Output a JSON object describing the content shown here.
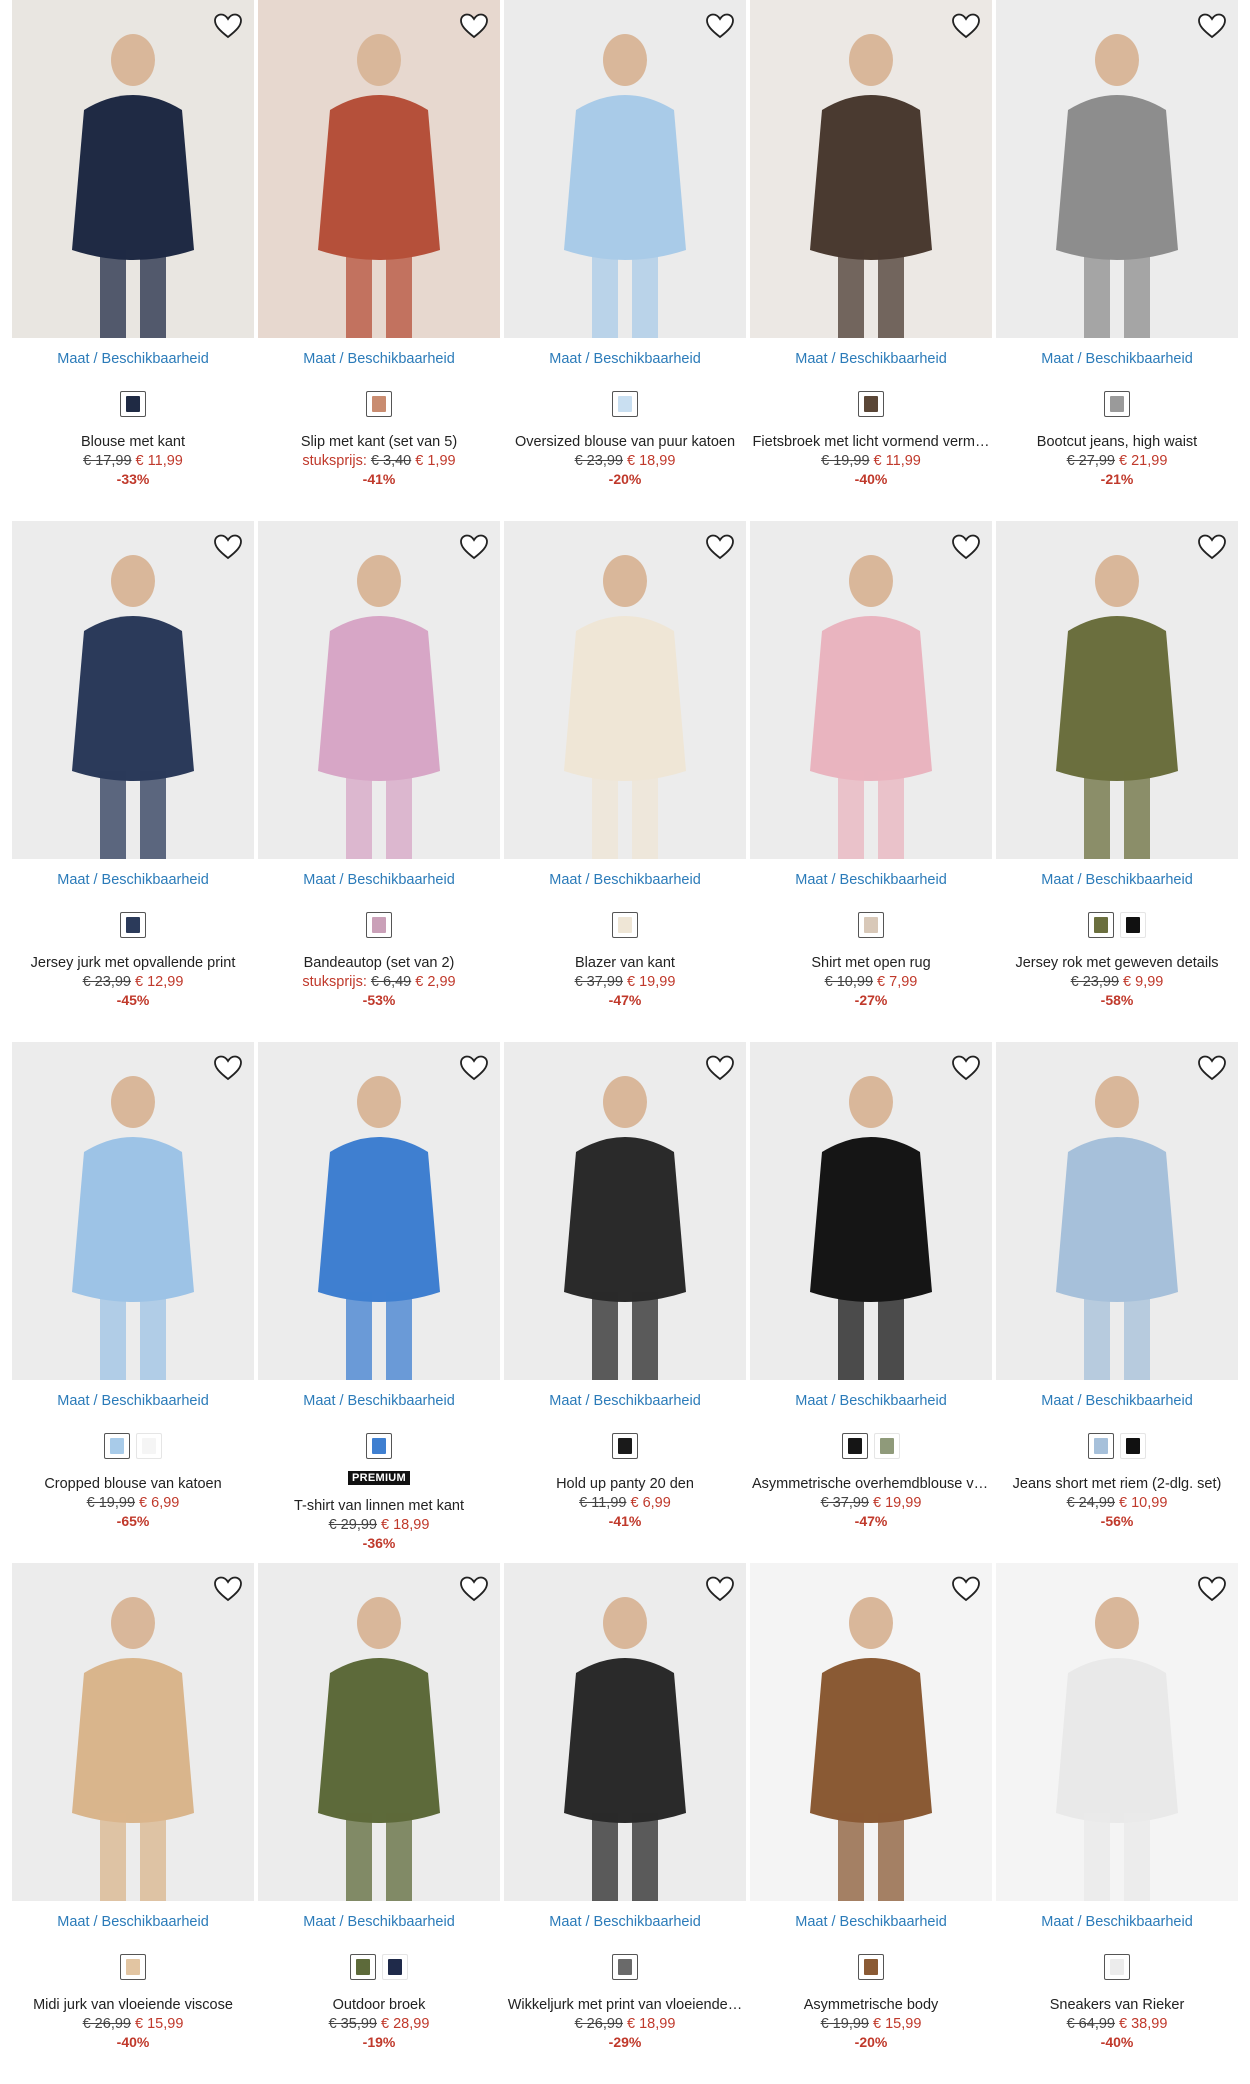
{
  "size_link_label": "Maat / Beschikbaarheid",
  "accent_link_color": "#2b7bb9",
  "price_color": "#c0392b",
  "products": [
    {
      "name": "Blouse met kant",
      "old_price": "€ 17,99",
      "new_price": "€ 11,99",
      "discount": "-33%",
      "price_label": "",
      "badge": "",
      "image_bg": "#e9e6e1",
      "figure": "#1f2a44",
      "swatches": [
        {
          "color": "#1f2a44"
        }
      ]
    },
    {
      "name": "Slip met kant (set van 5)",
      "old_price": "€ 3,40",
      "new_price": "€ 1,99",
      "discount": "-41%",
      "price_label": "stuksprijs:",
      "badge": "",
      "image_bg": "#e7d8cf",
      "figure": "#b5503a",
      "swatches": [
        {
          "color": "#c98c70"
        }
      ]
    },
    {
      "name": "Oversized blouse van puur katoen",
      "old_price": "€ 23,99",
      "new_price": "€ 18,99",
      "discount": "-20%",
      "price_label": "",
      "badge": "",
      "image_bg": "#ebebeb",
      "figure": "#a9cbe8",
      "swatches": [
        {
          "color": "#c9dff1"
        }
      ]
    },
    {
      "name": "Fietsbroek met licht vormend verm…",
      "old_price": "€ 19,99",
      "new_price": "€ 11,99",
      "discount": "-40%",
      "price_label": "",
      "badge": "",
      "image_bg": "#ece8e4",
      "figure": "#4a3a30",
      "swatches": [
        {
          "color": "#5a4636"
        }
      ]
    },
    {
      "name": "Bootcut jeans, high waist",
      "old_price": "€ 27,99",
      "new_price": "€ 21,99",
      "discount": "-21%",
      "price_label": "",
      "badge": "",
      "image_bg": "#ececec",
      "figure": "#8d8d8d",
      "swatches": [
        {
          "color": "#9a9a9a"
        }
      ]
    },
    {
      "name": "Jersey jurk met opvallende print",
      "old_price": "€ 23,99",
      "new_price": "€ 12,99",
      "discount": "-45%",
      "price_label": "",
      "badge": "",
      "image_bg": "#ececec",
      "figure": "#2b3a5a",
      "swatches": [
        {
          "color": "#2b3a5a"
        }
      ]
    },
    {
      "name": "Bandeautop (set van 2)",
      "old_price": "€ 6,49",
      "new_price": "€ 2,99",
      "discount": "-53%",
      "price_label": "stuksprijs:",
      "badge": "",
      "image_bg": "#ececec",
      "figure": "#d7a6c6",
      "swatches": [
        {
          "color": "#caa0b8"
        }
      ]
    },
    {
      "name": "Blazer van kant",
      "old_price": "€ 37,99",
      "new_price": "€ 19,99",
      "discount": "-47%",
      "price_label": "",
      "badge": "",
      "image_bg": "#ececec",
      "figure": "#efe6d6",
      "swatches": [
        {
          "color": "#efe6d6"
        }
      ]
    },
    {
      "name": "Shirt met open rug",
      "old_price": "€ 10,99",
      "new_price": "€ 7,99",
      "discount": "-27%",
      "price_label": "",
      "badge": "",
      "image_bg": "#ececec",
      "figure": "#e9b4bf",
      "swatches": [
        {
          "color": "#d8c8b8"
        }
      ]
    },
    {
      "name": "Jersey rok met geweven details",
      "old_price": "€ 23,99",
      "new_price": "€ 9,99",
      "discount": "-58%",
      "price_label": "",
      "badge": "",
      "image_bg": "#ececec",
      "figure": "#6b6f3e",
      "swatches": [
        {
          "color": "#6b6f3e"
        },
        {
          "color": "#111111",
          "plain": true
        }
      ]
    },
    {
      "name": "Cropped blouse van katoen",
      "old_price": "€ 19,99",
      "new_price": "€ 6,99",
      "discount": "-65%",
      "price_label": "",
      "badge": "",
      "image_bg": "#ececec",
      "figure": "#9dc3e6",
      "swatches": [
        {
          "color": "#a8cbe9"
        },
        {
          "color": "#f5f5f5",
          "plain": true
        }
      ]
    },
    {
      "name": "T-shirt van linnen met kant",
      "old_price": "€ 29,99",
      "new_price": "€ 18,99",
      "discount": "-36%",
      "price_label": "",
      "badge": "PREMIUM",
      "image_bg": "#ececec",
      "figure": "#3f7fd0",
      "swatches": [
        {
          "color": "#3f7fd0"
        }
      ]
    },
    {
      "name": "Hold up panty 20 den",
      "old_price": "€ 11,99",
      "new_price": "€ 6,99",
      "discount": "-41%",
      "price_label": "",
      "badge": "",
      "image_bg": "#ececec",
      "figure": "#2a2a2a",
      "swatches": [
        {
          "color": "#1a1a1a"
        }
      ]
    },
    {
      "name": "Asymmetrische overhemdblouse va…",
      "old_price": "€ 37,99",
      "new_price": "€ 19,99",
      "discount": "-47%",
      "price_label": "",
      "badge": "",
      "image_bg": "#ececec",
      "figure": "#151515",
      "swatches": [
        {
          "color": "#151515"
        },
        {
          "color": "#8f9a7a",
          "plain": true
        }
      ]
    },
    {
      "name": "Jeans short met riem (2-dlg. set)",
      "old_price": "€ 24,99",
      "new_price": "€ 10,99",
      "discount": "-56%",
      "price_label": "",
      "badge": "",
      "image_bg": "#ececec",
      "figure": "#a6c0da",
      "swatches": [
        {
          "color": "#a6c0da"
        },
        {
          "color": "#111111",
          "plain": true
        }
      ]
    },
    {
      "name": "Midi jurk van vloeiende viscose",
      "old_price": "€ 26,99",
      "new_price": "€ 15,99",
      "discount": "-40%",
      "price_label": "",
      "badge": "",
      "image_bg": "#ececec",
      "figure": "#d9b58c",
      "swatches": [
        {
          "color": "#e2c5a2"
        }
      ]
    },
    {
      "name": "Outdoor broek",
      "old_price": "€ 35,99",
      "new_price": "€ 28,99",
      "discount": "-19%",
      "price_label": "",
      "badge": "",
      "image_bg": "#ececec",
      "figure": "#5d6a3a",
      "swatches": [
        {
          "color": "#5d6a3a"
        },
        {
          "color": "#1f2a4a",
          "plain": true
        }
      ]
    },
    {
      "name": "Wikkeljurk met print van vloeiende…",
      "old_price": "€ 26,99",
      "new_price": "€ 18,99",
      "discount": "-29%",
      "price_label": "",
      "badge": "",
      "image_bg": "#ececec",
      "figure": "#2a2a2a",
      "swatches": [
        {
          "color": "#6a6a6a"
        }
      ]
    },
    {
      "name": "Asymmetrische body",
      "old_price": "€ 19,99",
      "new_price": "€ 15,99",
      "discount": "-20%",
      "price_label": "",
      "badge": "",
      "image_bg": "#f4f4f4",
      "figure": "#8a5a34",
      "swatches": [
        {
          "color": "#8a5a34"
        }
      ]
    },
    {
      "name": "Sneakers van Rieker",
      "old_price": "€ 64,99",
      "new_price": "€ 38,99",
      "discount": "-40%",
      "price_label": "",
      "badge": "",
      "image_bg": "#f4f4f4",
      "figure": "#e9e9e9",
      "swatches": [
        {
          "color": "#ececec"
        }
      ]
    }
  ]
}
